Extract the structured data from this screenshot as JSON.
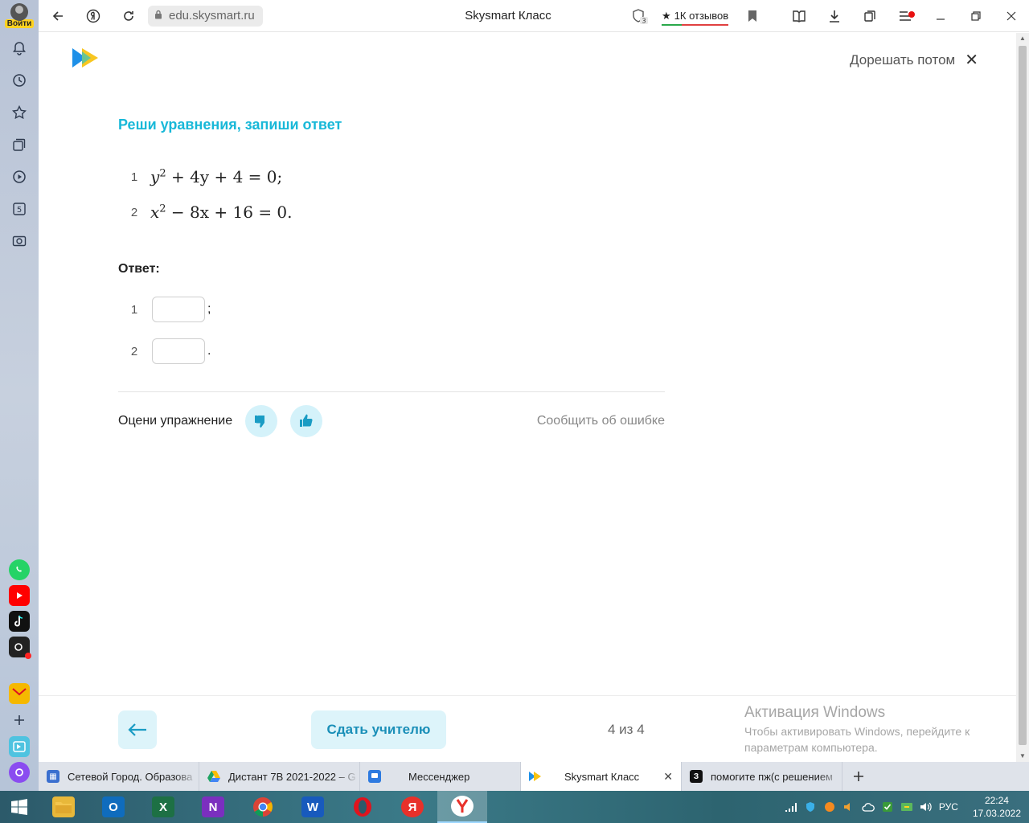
{
  "browser": {
    "url": "edu.skysmart.ru",
    "title": "Skysmart Класс",
    "reviews": "1К отзывов",
    "tab_badge": "3"
  },
  "sidebar": {
    "login_label": "Войти",
    "badge_5": "5"
  },
  "page": {
    "later_label": "Дорешать потом",
    "task_title": "Реши уравнения, запиши ответ",
    "equations": [
      {
        "num": "1",
        "lhs_var": "y",
        "rest": "+ 4y + 4 = 0;"
      },
      {
        "num": "2",
        "lhs_var": "x",
        "rest": "− 8x + 16 = 0."
      }
    ],
    "exponent": "2",
    "answer_label": "Ответ:",
    "answers": [
      {
        "num": "1",
        "value": "",
        "punct": ";"
      },
      {
        "num": "2",
        "value": "",
        "punct": "."
      }
    ],
    "rate_label": "Оцени упражнение",
    "report_label": "Сообщить об ошибке",
    "submit_label": "Сдать учителю",
    "progress": "4 из 4",
    "activation_title": "Активация Windows",
    "activation_text": "Чтобы активировать Windows, перейдите к параметрам компьютера."
  },
  "tabs": [
    {
      "label": "Сетевой Город. Образова",
      "active": false
    },
    {
      "label": "Дистант 7В 2021-2022 – G",
      "active": false
    },
    {
      "label": "Мессенджер",
      "active": false
    },
    {
      "label": "Skysmart Класс",
      "active": true
    },
    {
      "label": "помогите пж(с решением",
      "active": false
    }
  ],
  "taskbar": {
    "lang": "РУС",
    "time": "22:24",
    "date": "17.03.2022"
  },
  "colors": {
    "accent": "#18b8d8",
    "button_bg": "#ddf4fa",
    "button_text": "#1a8fb8"
  }
}
